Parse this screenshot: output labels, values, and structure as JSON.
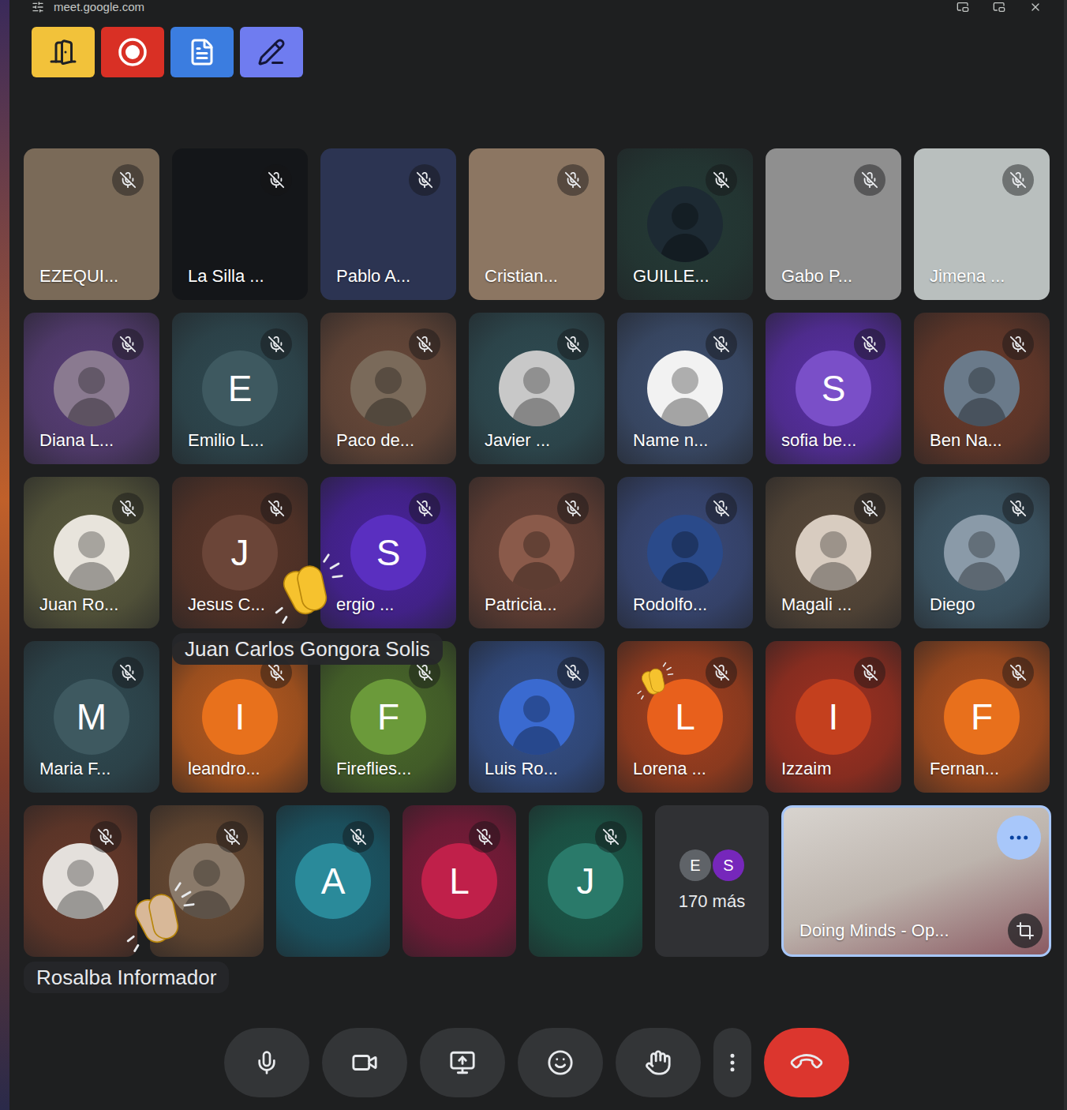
{
  "window": {
    "url": "meet.google.com"
  },
  "tiles": [
    {
      "name": "EZEQUI...",
      "kind": "video",
      "muted": true,
      "color": "#7a6a58"
    },
    {
      "name": "La Silla ...",
      "kind": "video",
      "muted": true,
      "color": "#141619"
    },
    {
      "name": "Pablo A...",
      "kind": "video",
      "muted": true,
      "color": "#2c3452"
    },
    {
      "name": "Cristian...",
      "kind": "video",
      "muted": true,
      "color": "#8c7662"
    },
    {
      "name": "GUILLE...",
      "kind": "photo",
      "muted": true,
      "color": "#243a36",
      "avatar_color": "#1d2a33"
    },
    {
      "name": "Gabo P...",
      "kind": "video",
      "muted": true,
      "color": "#8f8f8f"
    },
    {
      "name": "Jimena ...",
      "kind": "video",
      "muted": true,
      "color": "#b9bfbe"
    },
    {
      "name": "Diana L...",
      "kind": "photo",
      "muted": true,
      "color": "#5a3f7a",
      "avatar_color": "#8a7a90"
    },
    {
      "name": "Emilio L...",
      "kind": "letter",
      "letter": "E",
      "muted": true,
      "color": "#2f4a52",
      "avatar_color": "#3e5960"
    },
    {
      "name": "Paco de...",
      "kind": "photo",
      "muted": true,
      "color": "#6b4a3a",
      "avatar_color": "#7a6a5a"
    },
    {
      "name": "Javier ...",
      "kind": "photo",
      "muted": true,
      "color": "#2f4d54",
      "avatar_color": "#c8c8c8"
    },
    {
      "name": "Name n...",
      "kind": "photo",
      "muted": true,
      "color": "#3d4f70",
      "avatar_color": "#f2f2f2"
    },
    {
      "name": "sofia be...",
      "kind": "letter",
      "letter": "S",
      "muted": true,
      "color": "#5a2fa8",
      "avatar_color": "#7a4fc8"
    },
    {
      "name": "Ben Na...",
      "kind": "photo",
      "muted": true,
      "color": "#6a3a2a",
      "avatar_color": "#6a7a8a"
    },
    {
      "name": "Juan Ro...",
      "kind": "photo",
      "muted": true,
      "color": "#5c5c3e",
      "avatar_color": "#e8e4dc"
    },
    {
      "name": "Jesus C...",
      "kind": "letter",
      "letter": "J",
      "muted": true,
      "color": "#5a3528",
      "avatar_color": "#6b4538",
      "reaction": {
        "kind": "floating",
        "sender": "Juan Carlos Gongora Solis",
        "color": "#f6c22e"
      }
    },
    {
      "name": "ergio ...",
      "kind": "letter",
      "letter": "S",
      "muted": true,
      "color": "#4a22a0",
      "avatar_color": "#5a2fc0"
    },
    {
      "name": "Patricia...",
      "kind": "photo",
      "muted": true,
      "color": "#6a4236",
      "avatar_color": "#8a5a4a"
    },
    {
      "name": "Rodolfo...",
      "kind": "photo",
      "muted": true,
      "color": "#3a4a7a",
      "avatar_color": "#2a4a8a"
    },
    {
      "name": "Magali ...",
      "kind": "photo",
      "muted": true,
      "color": "#5a4a3a",
      "avatar_color": "#d8ccc0"
    },
    {
      "name": "Diego",
      "kind": "photo",
      "muted": true,
      "color": "#3f5a6a",
      "avatar_color": "#8a9aa8"
    },
    {
      "name": "Maria F...",
      "kind": "letter",
      "letter": "M",
      "muted": true,
      "color": "#2f4a52",
      "avatar_color": "#3e5960"
    },
    {
      "name": "leandro...",
      "kind": "letter",
      "letter": "I",
      "muted": true,
      "color": "#b85a1e",
      "avatar_color": "#e8711c"
    },
    {
      "name": "Fireflies...",
      "kind": "letter",
      "letter": "F",
      "muted": true,
      "color": "#4a6a2a",
      "avatar_color": "#6b9a3a"
    },
    {
      "name": "Luis Ro...",
      "kind": "photo",
      "muted": true,
      "color": "#34508a",
      "avatar_color": "#3a6ad0"
    },
    {
      "name": "Lorena ...",
      "kind": "letter",
      "letter": "L",
      "muted": true,
      "color": "#a4401e",
      "avatar_color": "#e8601c",
      "reaction": {
        "kind": "badge",
        "sender": "",
        "color": "#f6c22e"
      }
    },
    {
      "name": "Izzaim",
      "kind": "letter",
      "letter": "I",
      "muted": true,
      "color": "#a03020",
      "avatar_color": "#c4401e"
    },
    {
      "name": "Fernan...",
      "kind": "letter",
      "letter": "F",
      "muted": true,
      "color": "#b0501e",
      "avatar_color": "#e8701c"
    },
    {
      "name": "",
      "kind": "photo",
      "muted": true,
      "color": "#6a3a2a",
      "avatar_color": "#e4e0dc",
      "reaction": {
        "kind": "floating",
        "sender": "Rosalba Informador",
        "color": "#d8b898"
      }
    },
    {
      "name": "",
      "kind": "photo",
      "muted": true,
      "color": "#6a4a32",
      "avatar_color": "#8a7a6a"
    },
    {
      "name": "",
      "kind": "letter",
      "letter": "A",
      "muted": true,
      "color": "#1a5a6a",
      "avatar_color": "#2a8a9a"
    },
    {
      "name": "",
      "kind": "letter",
      "letter": "L",
      "muted": true,
      "color": "#7e1a3a",
      "avatar_color": "#c0204a"
    },
    {
      "name": "",
      "kind": "letter",
      "letter": "J",
      "muted": true,
      "color": "#1a5a4a",
      "avatar_color": "#2a7a6a"
    }
  ],
  "overflow": {
    "label": "170 más",
    "avatars": [
      {
        "letter": "E",
        "color": "#5f6368"
      },
      {
        "letter": "S",
        "color": "#7627bb"
      }
    ]
  },
  "self": {
    "name": "Doing Minds - Op..."
  },
  "controls": {
    "mic_on": true,
    "camera_on": true
  }
}
